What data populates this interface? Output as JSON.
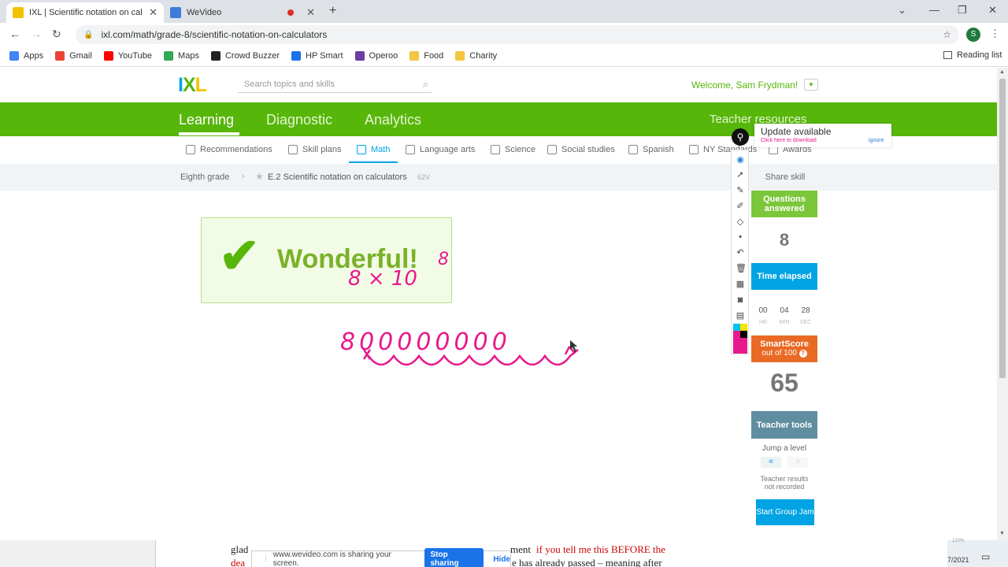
{
  "browser": {
    "tabs": [
      {
        "title": "IXL | Scientific notation on calcul",
        "icon": "ixl-tab-icon"
      },
      {
        "title": "WeVideo",
        "icon": "wevideo-tab-icon"
      }
    ],
    "url": "ixl.com/math/grade-8/scientific-notation-on-calculators",
    "profile_initial": "S",
    "bookmarks": [
      {
        "label": "Apps",
        "color": "#4285f4"
      },
      {
        "label": "Gmail",
        "color": "#ea4335"
      },
      {
        "label": "YouTube",
        "color": "#ff0000"
      },
      {
        "label": "Maps",
        "color": "#34a853"
      },
      {
        "label": "Crowd Buzzer",
        "color": "#222222"
      },
      {
        "label": "HP Smart",
        "color": "#1a73e8"
      },
      {
        "label": "Operoo",
        "color": "#6a3fa0"
      },
      {
        "label": "Food",
        "color": "#f4c542"
      },
      {
        "label": "Charity",
        "color": "#f4c542"
      }
    ],
    "reading_list": "Reading list"
  },
  "ixl": {
    "logo": "IXL",
    "search_placeholder": "Search topics and skills",
    "welcome": "Welcome, Sam Frydman!",
    "nav": {
      "learning": "Learning",
      "diagnostic": "Diagnostic",
      "analytics": "Analytics",
      "teacher": "Teacher resources"
    },
    "subnav": [
      "Recommendations",
      "Skill plans",
      "Math",
      "Language arts",
      "Science",
      "Social studies",
      "Spanish",
      "NY Standards",
      "Awards"
    ],
    "breadcrumb": {
      "grade": "Eighth grade",
      "skill": "E.2 Scientific notation on calculators",
      "code": "62V"
    },
    "feedback": "Wonderful!",
    "share_skill": "Share skill",
    "questions_label": "Questions answered",
    "questions_value": "8",
    "time_label": "Time elapsed",
    "time": {
      "hr": "00",
      "min": "04",
      "sec": "28"
    },
    "time_units": {
      "hr": "HR",
      "min": "MIN",
      "sec": "SEC"
    },
    "smartscore_label": "SmartScore",
    "smartscore_sub": "out of 100",
    "smartscore_value": "65",
    "teacher_tools": "Teacher tools",
    "jump_level": "Jump a level",
    "results_note": "Teacher results not recorded",
    "group_jam": "Start Group Jam"
  },
  "annotation_popup": {
    "title": "Update available",
    "sub": "Click here to download",
    "ignore": "ignore"
  },
  "handwriting": {
    "exponent": "8",
    "formula": "8 × 10",
    "number": "800000000"
  },
  "sharing": {
    "message": "www.wevideo.com is sharing your screen.",
    "stop": "Stop sharing",
    "hide": "Hide"
  },
  "background_doc": {
    "line1_left": "glad",
    "line1_mid": "ment",
    "line1_red": "if you tell me this BEFORE the",
    "line2_left": "dea",
    "line2_right": "e has already passed – meaning after"
  },
  "taskbar": {
    "time": "7/2021",
    "pct": "120%"
  },
  "colors": {
    "ixl_green": "#56b60a",
    "ixl_blue": "#00a4e4",
    "ink_pink": "#e8198b",
    "smartscore": "#e96a25",
    "teacher": "#5f8ea0"
  }
}
